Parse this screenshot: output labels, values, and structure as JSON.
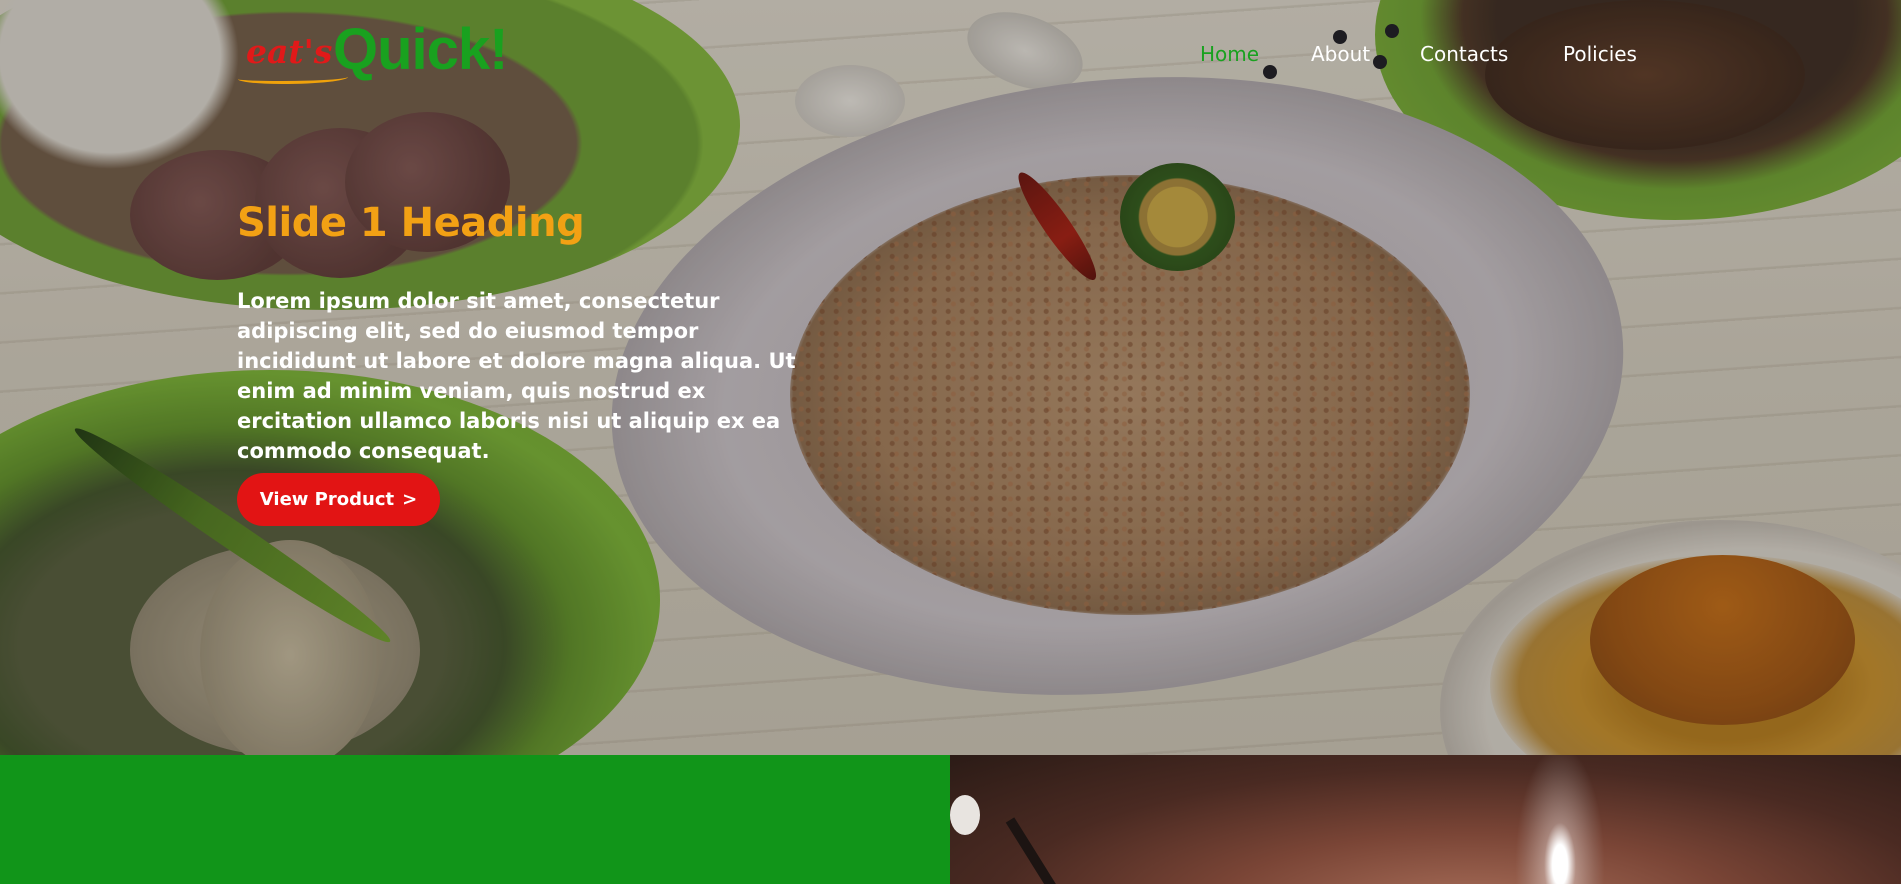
{
  "brand": {
    "logo_script": "eat's",
    "logo_main": "Quick!",
    "colors": {
      "green": "#19a11f",
      "red": "#e21414",
      "orange": "#f2a114"
    }
  },
  "nav": {
    "items": [
      {
        "label": "Home",
        "active": true
      },
      {
        "label": "About",
        "active": false
      },
      {
        "label": "Contacts",
        "active": false
      },
      {
        "label": "Policies",
        "active": false
      }
    ]
  },
  "hero": {
    "heading": "Slide 1 Heading",
    "body": "Lorem ipsum dolor sit amet, consectetur adipiscing elit, sed do eiusmod tempor incididunt ut labore et dolore magna aliqua. Ut enim ad minim veniam, quis nostrud ex ercitation ullamco laboris nisi ut aliquip ex ea commodo consequat.",
    "button_label": "View Product",
    "button_icon": "chevron-right-icon",
    "button_glyph": ">"
  }
}
